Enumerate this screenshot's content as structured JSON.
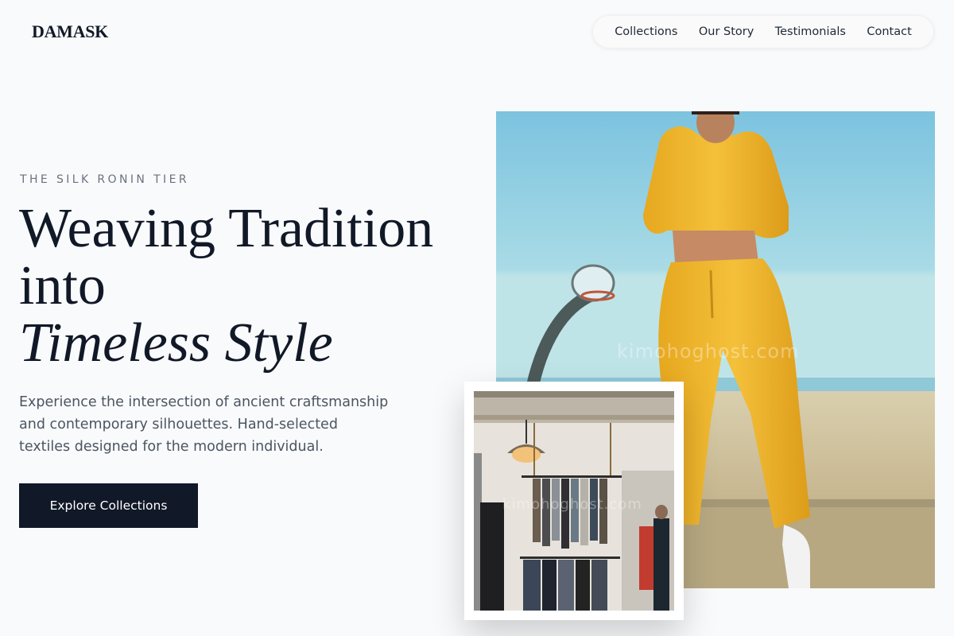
{
  "brand": {
    "logo": "DAMASK"
  },
  "nav": {
    "items": [
      {
        "label": "Collections"
      },
      {
        "label": "Our Story"
      },
      {
        "label": "Testimonials"
      },
      {
        "label": "Contact"
      }
    ]
  },
  "hero": {
    "eyebrow": "THE SILK RONIN TIER",
    "headline_line1": "Weaving Tradition",
    "headline_line2": "into",
    "headline_line3": "Timeless Style",
    "description": "Experience the intersection of ancient craftsmanship and contemporary silhouettes. Hand-selected textiles designed for the modern individual.",
    "cta_label": "Explore Collections"
  },
  "images": {
    "main": {
      "subject": "model in yellow cropped hoodie and sweatpants by a basketball hoop",
      "watermark": "kimohoghost.com"
    },
    "inset": {
      "subject": "clothing boutique interior with hanging garment rack",
      "watermark": "kimohoghost.com"
    }
  },
  "colors": {
    "background": "#f9fafb",
    "text_primary": "#111827",
    "text_muted": "#6b7280",
    "button_bg": "#111827",
    "button_text": "#ffffff"
  }
}
